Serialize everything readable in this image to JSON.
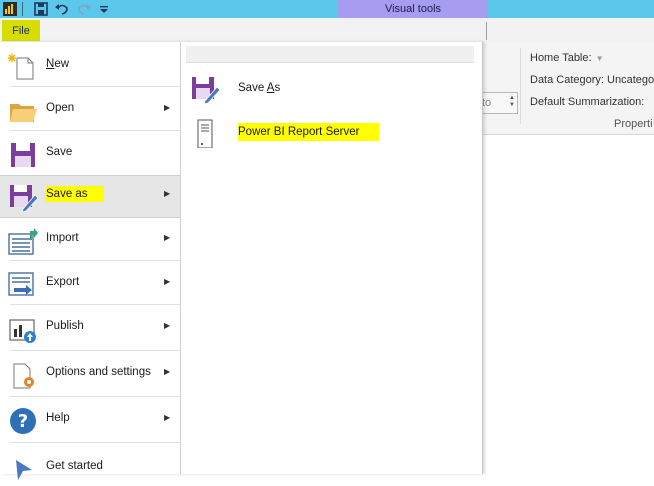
{
  "title_bar": {
    "contextual_tab": "Visual tools"
  },
  "ribbon": {
    "file_tab": "File",
    "properties": {
      "home_table": "Home Table:",
      "data_category": "Data Category: Uncatego",
      "default_summarization": "Default Summarization:",
      "auto_value": "to",
      "group_label": "Properti"
    }
  },
  "menu": {
    "items": [
      {
        "label": "New",
        "underline": "N",
        "rest": "ew",
        "has_submenu": false,
        "icon": "new-file-icon"
      },
      {
        "label": "Open",
        "has_submenu": true,
        "icon": "folder-icon"
      },
      {
        "label": "Save",
        "has_submenu": false,
        "icon": "save-icon"
      },
      {
        "label": "Save as",
        "has_submenu": true,
        "selected": true,
        "icon": "save-as-icon"
      },
      {
        "label": "Import",
        "has_submenu": true,
        "icon": "import-icon"
      },
      {
        "label": "Export",
        "has_submenu": true,
        "icon": "export-icon"
      },
      {
        "label": "Publish",
        "has_submenu": true,
        "icon": "publish-icon"
      },
      {
        "label": "Options and settings",
        "has_submenu": true,
        "icon": "options-gear-icon"
      },
      {
        "label": "Help",
        "has_submenu": true,
        "icon": "help-icon"
      },
      {
        "label": "Get started",
        "has_submenu": false,
        "icon": "get-started-icon"
      }
    ]
  },
  "submenu": {
    "items": [
      {
        "label_prefix": "Save ",
        "underline": "A",
        "label_suffix": "s",
        "icon": "save-as-icon"
      },
      {
        "label": "Power BI Report Server",
        "icon": "server-icon",
        "highlighted": true
      }
    ]
  },
  "colors": {
    "title_bar": "#5bc8eb",
    "contextual_tab": "#a79df0",
    "file_tab": "#d8dd00",
    "highlight": "#ffff00",
    "save_purple": "#7a3f9d"
  }
}
